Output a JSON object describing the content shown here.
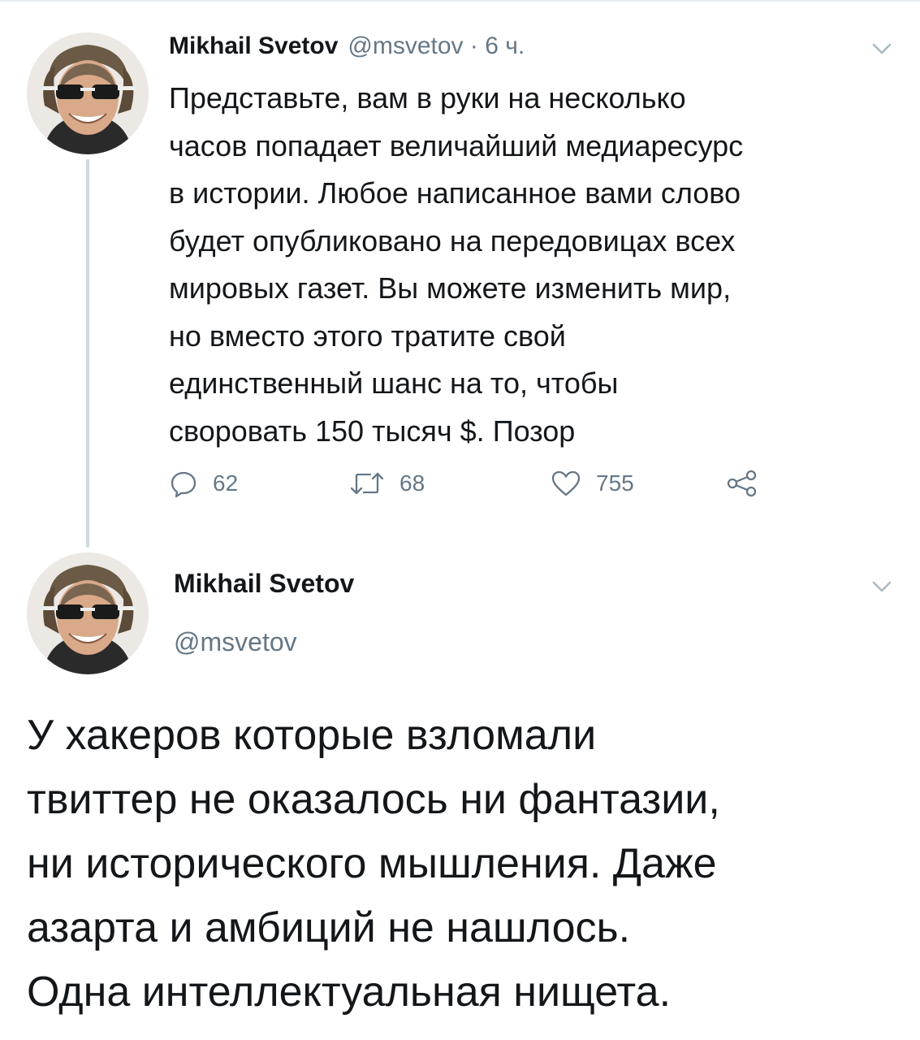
{
  "thread": {
    "tweets": [
      {
        "author_name": "Mikhail Svetov",
        "handle_time": "@msvetov · 6 ч.",
        "text": "Представьте, вам в руки на несколько\nчасов попадает величайший медиаресурс\nв истории. Любое написанное вами слово\nбудет опубликовано на передовицах всех\nмировых газет. Вы можете изменить мир,\nно вместо этого тратите свой\nединственный шанс на то, чтобы\nсворовать 150 тысяч $. Позор",
        "stats": {
          "replies": "62",
          "retweets": "68",
          "likes": "755"
        }
      },
      {
        "author_name": "Mikhail Svetov",
        "handle": "@msvetov",
        "text": "У хакеров которые взломали\nтвиттер не оказалось ни фантазии,\nни исторического мышления. Даже\nазарта и амбиций не нашлось.\nОдна интеллектуальная нищета."
      }
    ]
  },
  "icons": {
    "reply": "reply-icon",
    "retweet": "retweet-icon",
    "like": "heart-icon",
    "share": "share-icon",
    "menu": "chevron-down-icon"
  },
  "colors": {
    "text_primary": "#14171a",
    "text_secondary": "#657786",
    "thread_line": "#cfd9de",
    "divider": "#e6ecf0"
  }
}
